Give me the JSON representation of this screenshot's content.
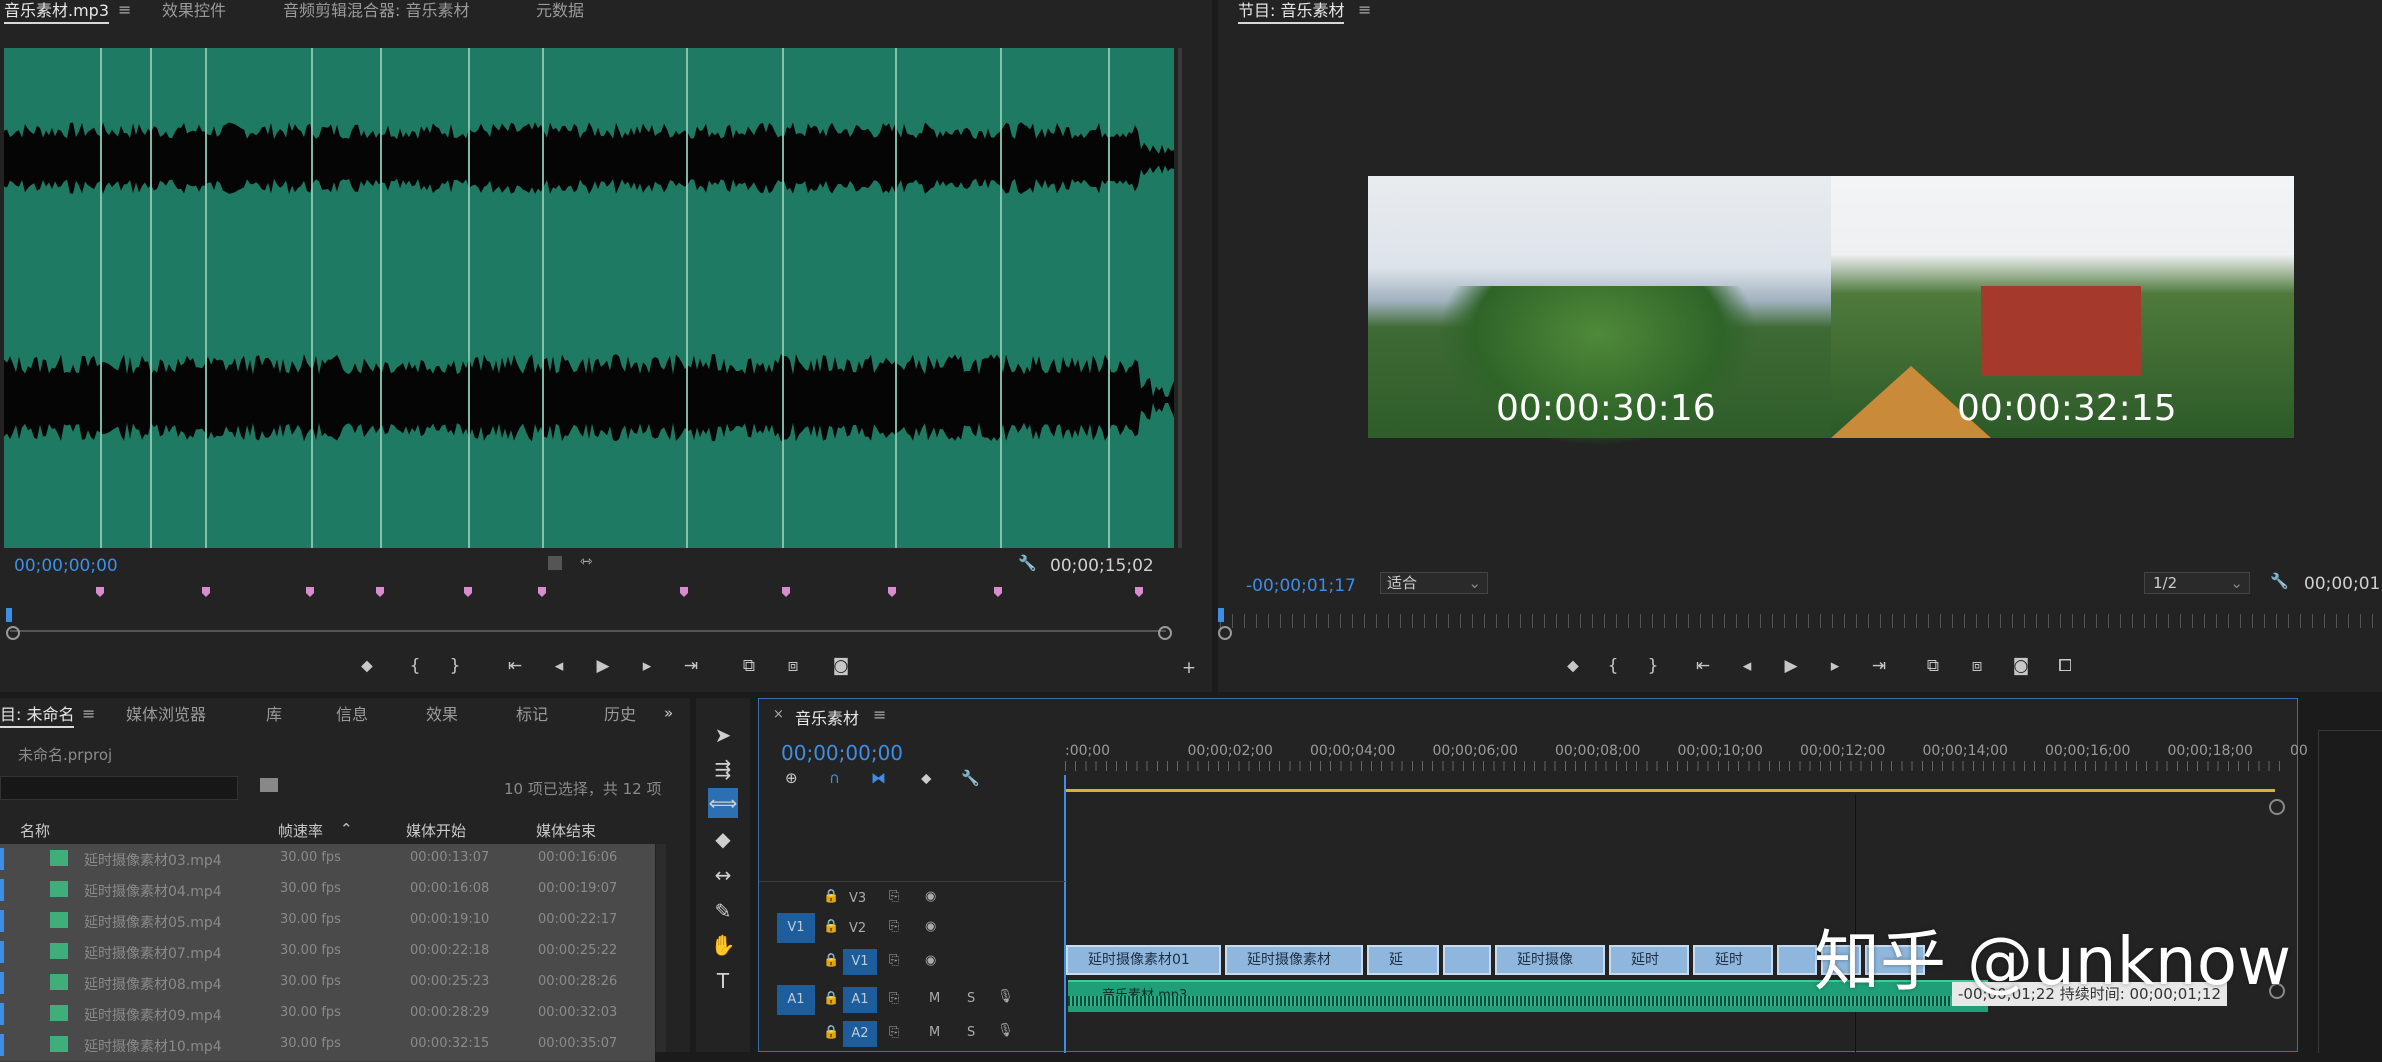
{
  "source_panel": {
    "tabs": [
      "音乐素材.mp3",
      "效果控件",
      "音频剪辑混合器: 音乐素材",
      "元数据"
    ],
    "timecode_in": "00;00;00;00",
    "timecode_out": "00;00;15;02",
    "marker_color": "#d98cd0",
    "waveform_color": "#1e7a62"
  },
  "program_panel": {
    "title": "节目: 音乐素材",
    "timecode": "-00;00;01;17",
    "fit_label": "适合",
    "resolution_label": "1/2",
    "timecode_right": "00;00;01;",
    "frame_left_time": "00:00:30:16",
    "frame_right_time": "00:00:32:15"
  },
  "project_panel": {
    "tabs": [
      "目: 未命名",
      "媒体浏览器",
      "库",
      "信息",
      "效果",
      "标记",
      "历史"
    ],
    "project_file": "未命名.prproj",
    "selection_info": "10 项已选择，共 12 项",
    "columns": [
      "名称",
      "帧速率",
      "媒体开始",
      "媒体结束"
    ],
    "rows": [
      {
        "name": "延时摄像素材03.mp4",
        "fps": "30.00 fps",
        "start": "00:00:13:07",
        "end": "00:00:16:06"
      },
      {
        "name": "延时摄像素材04.mp4",
        "fps": "30.00 fps",
        "start": "00:00:16:08",
        "end": "00:00:19:07"
      },
      {
        "name": "延时摄像素材05.mp4",
        "fps": "30.00 fps",
        "start": "00:00:19:10",
        "end": "00:00:22:17"
      },
      {
        "name": "延时摄像素材07.mp4",
        "fps": "30.00 fps",
        "start": "00:00:22:18",
        "end": "00:00:25:22"
      },
      {
        "name": "延时摄像素材08.mp4",
        "fps": "30.00 fps",
        "start": "00:00:25:23",
        "end": "00:00:28:26"
      },
      {
        "name": "延时摄像素材09.mp4",
        "fps": "30.00 fps",
        "start": "00:00:28:29",
        "end": "00:00:32:03"
      },
      {
        "name": "延时摄像素材10.mp4",
        "fps": "30.00 fps",
        "start": "00:00:32:15",
        "end": "00:00:35:07"
      }
    ]
  },
  "timeline_panel": {
    "title": "音乐素材",
    "timecode": "00;00;00;00",
    "ruler": [
      ":00;00",
      "00;00;02;00",
      "00;00;04;00",
      "00;00;06;00",
      "00;00;08;00",
      "00;00;10;00",
      "00;00;12;00",
      "00;00;14;00",
      "00;00;16;00",
      "00;00;18;00",
      "00"
    ],
    "tracks": {
      "v3": "V3",
      "v2": "V2",
      "v1": "V1",
      "v1_src": "V1",
      "a1": "A1",
      "a1_src": "A1",
      "a2": "A2",
      "m": "M",
      "s": "S"
    },
    "video_clips": [
      "延时摄像素材01",
      "延时摄像素材",
      "延",
      "",
      "延时摄像",
      "延时",
      "延时",
      "",
      "",
      ""
    ],
    "audio_clip": "音乐素材.mp3",
    "tooltip": "-00;00;01;22 持续时间: 00;00;01;12"
  },
  "watermark": "知乎 @unknow"
}
